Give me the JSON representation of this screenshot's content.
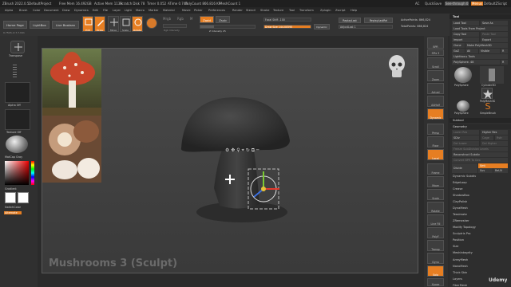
{
  "titlebar": {
    "app": "ZBrush 2022.0.5",
    "project": "DefaultProject",
    "free_mem": "Free Mem 16.492GB",
    "active_mem": "Active Mem 1139",
    "scratch": "Scratch Disk 78",
    "timer": "Timer 0.052",
    "atime": "ATime 0.745",
    "polycount": "PolyCount 866.816 KP",
    "meshcount": "MeshCount 1",
    "ac": "AC",
    "quicksave": "QuickSave",
    "seethrough": "See-through 0",
    "menus": "Menus",
    "default_script": "DefaultZScript"
  },
  "menubar": [
    "Alpha",
    "Brush",
    "Color",
    "Document",
    "Draw",
    "Dynamics",
    "Edit",
    "File",
    "Layer",
    "Light",
    "Macro",
    "Marker",
    "Material",
    "Movie",
    "Picker",
    "Preferences",
    "Render",
    "Stencil",
    "Stroke",
    "Texture",
    "Tool",
    "Transform",
    "Zplugin",
    "Zscript",
    "Help"
  ],
  "toolbar": {
    "home_page": "Home Page",
    "lightbox": "LightBox",
    "live_boolean": "Live Boolean",
    "edit": "Edit",
    "draw": "Draw",
    "move": "Move",
    "scale": "Scale",
    "rotate": "Rotate",
    "mrgb": "Mrgb",
    "rgb": "Rgb",
    "m": "M",
    "zadd": "Zadd",
    "zsub": "Zsub",
    "rgb_intensity": "Rgb Intensity",
    "z_intensity": "Z Intensity 25",
    "focal_shift": "Focal Shift -100",
    "draw_size": "Draw Size 144.00595",
    "dynamic": "Dynamic",
    "replay_last": "ReplayLast",
    "replay_last_rel": "ReplayLastRel",
    "adjust_last": "AdjustLast 1",
    "active_points": "ActivePoints: 866,824",
    "total_points": "TotalPoints: 866,824",
    "coords": "0.7503,-0.7,7.041"
  },
  "left_shelf": {
    "transpose": "Transpose",
    "alpha_off": "Alpha Off",
    "texture_off": "Texture Off",
    "matcap_gray": "MatCap Gray",
    "gradient": "Gradient",
    "switch_color": "SwitchColor",
    "alternate": "Alternate"
  },
  "canvas": {
    "watermark": "Mushrooms 3",
    "watermark_sub": "(Sculpt)",
    "colors": {
      "canvas_top": "#4a4a4a",
      "model": "#2f2f2f",
      "accent": "#e67e22"
    }
  },
  "right_shelf": [
    "BPR",
    "SPix 3",
    "Scroll",
    "Zoom",
    "Actual",
    "AAHalf",
    "Dynamic",
    "Persp",
    "Floor",
    "Local",
    "Frame",
    "Move",
    "Scale",
    "Rotate",
    "Line Fill",
    "PolyF",
    "Transp",
    "Dyna",
    "Solo",
    "Xpose"
  ],
  "tray": {
    "header": "Tool",
    "load_tool": "Load Tool",
    "save_as": "Save As",
    "load_tools_from_project": "Load Tools From Project",
    "copy_tool": "Copy Tool",
    "paste_tool": "Paste Tool",
    "import": "Import",
    "export": "Export",
    "clone": "Clone",
    "make_polymesh": "Make PolyMesh3D",
    "goz": "GoZ",
    "all": "All",
    "visible": "Visible",
    "r": "R",
    "lightbox_tools": "Lightbox ▸ Tools",
    "polysphere_slider": "PolySphere. 48",
    "r2": "R",
    "tools": [
      "PolySphere",
      "Cylinder3D",
      "PolyMesh3D",
      "PolySphere",
      "SimpleBrush"
    ],
    "subtool": "Subtool",
    "geometry": "Geometry",
    "lower_res": "Lower Res",
    "higher_res": "Higher Res",
    "sdiv": "SDiv",
    "cage": "Cage",
    "rstr": "Rstr",
    "del_lower": "Del Lower",
    "del_higher": "Del Higher",
    "freeze_subdiv": "Freeze SubDivision Levels",
    "reconstruct_subdiv": "Reconstruct Subdiv",
    "convert_bpr": "Convert BPR To Geo",
    "divide": "Divide",
    "smt": "Smt",
    "suv": "Suv",
    "reuv": "ReUV",
    "sections": [
      "Dynamic Subdiv",
      "EdgeLoop",
      "Crease",
      "ShadowBox",
      "ClayPolish",
      "DynaMesh",
      "Tessimate",
      "ZRemesher",
      "Modify Topology",
      "Sculptris Pro",
      "Position",
      "Size",
      "MeshIntegrity"
    ],
    "lower_sections": [
      "ArrayMesh",
      "NanoMesh",
      "Thick Skin",
      "Layers",
      "FiberMesh"
    ]
  },
  "branding": "Udemy"
}
